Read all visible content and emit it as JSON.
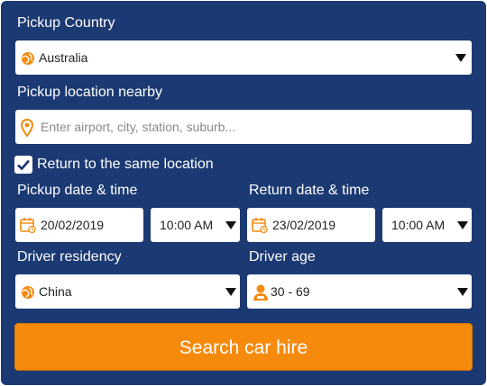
{
  "colors": {
    "panel_bg": "#1b3a73",
    "accent": "#f68a0c",
    "field_bg": "#ffffff"
  },
  "pickup_country": {
    "label": "Pickup Country",
    "value": "Australia",
    "icon": "globe-icon"
  },
  "pickup_location": {
    "label": "Pickup location nearby",
    "placeholder": "Enter airport, city, station, suburb...",
    "icon": "location-pin-icon"
  },
  "same_location": {
    "label": "Return to the same location",
    "checked": true
  },
  "pickup_datetime": {
    "label": "Pickup date & time",
    "date": "20/02/2019",
    "time": "10:00 AM",
    "icon": "calendar-icon"
  },
  "return_datetime": {
    "label": "Return date & time",
    "date": "23/02/2019",
    "time": "10:00 AM",
    "icon": "calendar-icon"
  },
  "driver_residency": {
    "label": "Driver residency",
    "value": "China",
    "icon": "globe-icon"
  },
  "driver_age": {
    "label": "Driver age",
    "value": "30 - 69",
    "icon": "person-icon"
  },
  "search_button": {
    "label": "Search car hire"
  }
}
